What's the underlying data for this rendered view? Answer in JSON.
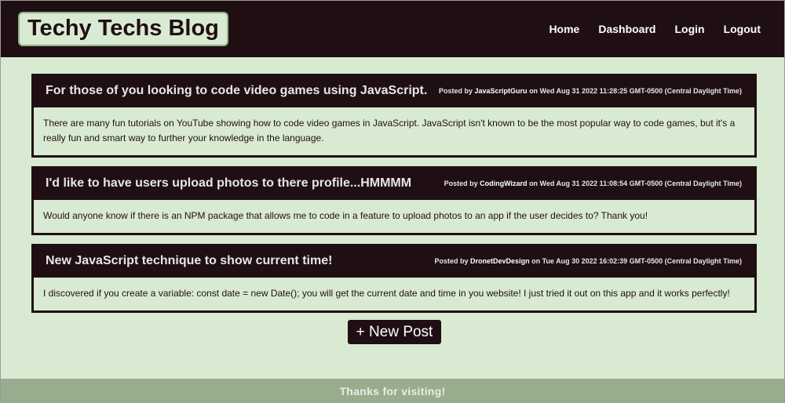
{
  "header": {
    "brand": "Techy Techs Blog",
    "nav": [
      "Home",
      "Dashboard",
      "Login",
      "Logout"
    ]
  },
  "posts": [
    {
      "title": "For those of you looking to code video games using JavaScript.",
      "posted_by_label": "Posted by",
      "author": "JavaScriptGuru",
      "date": "on Wed Aug 31 2022 11:28:25 GMT-0500 (Central Daylight Time)",
      "body": "There are many fun tutorials on YouTube showing how to code video games in JavaScript. JavaScript isn't known to be the most popular way to code games, but it's a really fun and smart way to further your knowledge in the language."
    },
    {
      "title": "I'd like to have users upload photos to there profile...HMMMM",
      "posted_by_label": "Posted by",
      "author": "CodingWizard",
      "date": "on Wed Aug 31 2022 11:08:54 GMT-0500 (Central Daylight Time)",
      "body": "Would anyone know if there is an NPM package that allows me to code in a feature to upload photos to an app if the user decides to? Thank you!"
    },
    {
      "title": "New JavaScript technique to show current time!",
      "posted_by_label": "Posted by",
      "author": "DronetDevDesign",
      "date": "on Tue Aug 30 2022 16:02:39 GMT-0500 (Central Daylight Time)",
      "body": "I discovered if you create a variable: const date = new Date(); you will get the current date and time in you website! I just tried it out on this app and it works perfectly!"
    }
  ],
  "new_post_label": "+ New Post",
  "footer": "Thanks for visiting!",
  "colors": {
    "dark": "#1f0f12",
    "background": "#d9ead3",
    "footer": "#97ad8e"
  }
}
